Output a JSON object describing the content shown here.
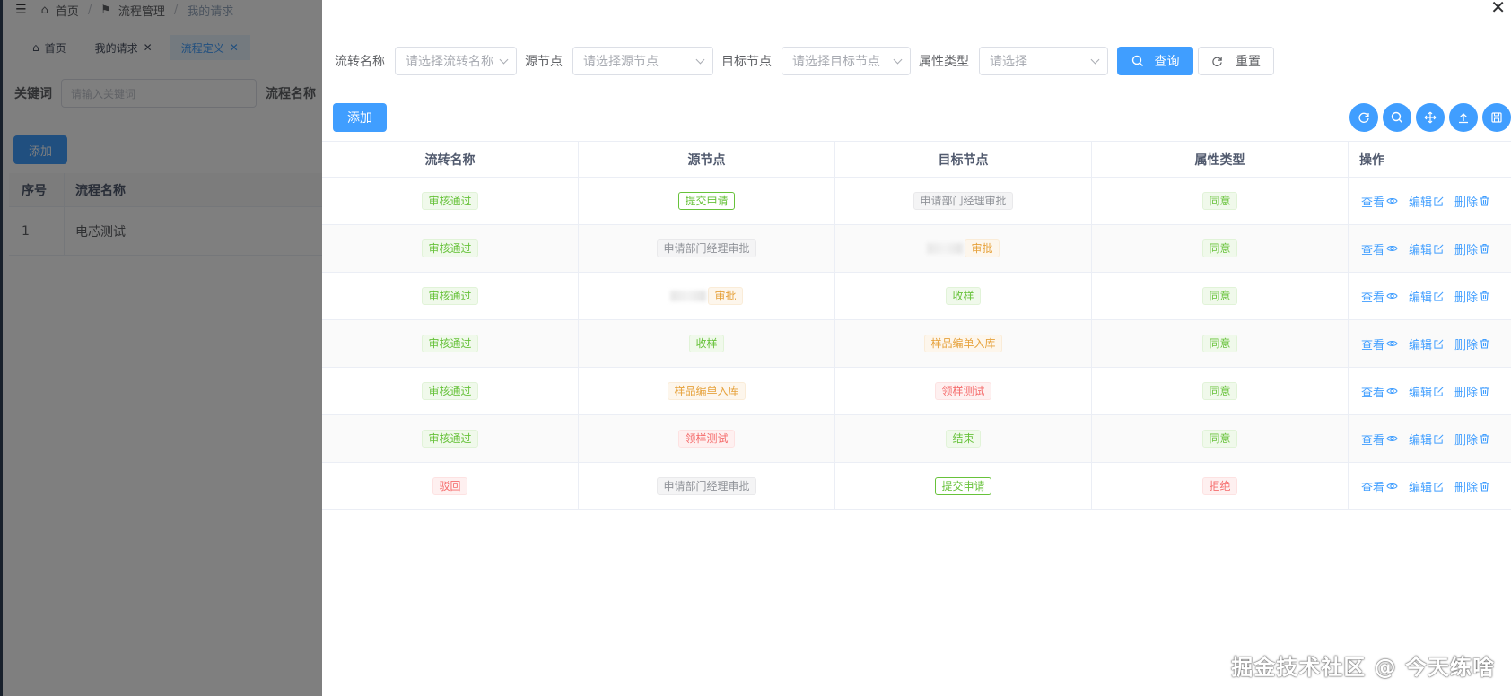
{
  "background": {
    "breadcrumb": [
      "首页",
      "流程管理",
      "我的请求"
    ],
    "tabs": [
      {
        "label": "首页",
        "closable": false,
        "active": false
      },
      {
        "label": "我的请求",
        "closable": true,
        "active": false
      },
      {
        "label": "流程定义",
        "closable": true,
        "active": true
      }
    ],
    "search": {
      "keyword_label": "关键词",
      "keyword_placeholder": "请输入关键词",
      "name_label": "流程名称"
    },
    "add_label": "添加",
    "table": {
      "headers": [
        "序号",
        "流程名称"
      ],
      "rows": [
        [
          "1",
          "电芯测试"
        ]
      ]
    }
  },
  "drawer": {
    "filters": [
      {
        "label": "流转名称",
        "placeholder": "请选择流转名称"
      },
      {
        "label": "源节点",
        "placeholder": "请选择源节点"
      },
      {
        "label": "目标节点",
        "placeholder": "请选择目标节点"
      },
      {
        "label": "属性类型",
        "placeholder": "请选择"
      }
    ],
    "query_label": "查询",
    "reset_label": "重置",
    "add_label": "添加",
    "toolbar_icons": [
      "refresh-icon",
      "search-icon",
      "move-icon",
      "upload-icon",
      "save-icon"
    ],
    "table": {
      "headers": [
        "流转名称",
        "源节点",
        "目标节点",
        "属性类型",
        "操作"
      ],
      "rows": [
        {
          "name": "审核通过",
          "source": "提交申请",
          "target": "申请部门经理审批",
          "type": "同意"
        },
        {
          "name": "审核通过",
          "source": "申请部门经理审批",
          "target": "审批",
          "type": "同意"
        },
        {
          "name": "审核通过",
          "source": "审批",
          "target": "收样",
          "type": "同意"
        },
        {
          "name": "审核通过",
          "source": "收样",
          "target": "样品编单入库",
          "type": "同意"
        },
        {
          "name": "审核通过",
          "source": "样品编单入库",
          "target": "领样测试",
          "type": "同意"
        },
        {
          "name": "审核通过",
          "source": "领样测试",
          "target": "结束",
          "type": "同意"
        },
        {
          "name": "驳回",
          "source": "申请部门经理审批",
          "target": "提交申请",
          "type": "拒绝"
        }
      ],
      "ops": {
        "view": "查看",
        "edit": "编辑",
        "delete": "删除"
      }
    }
  },
  "watermark": "掘金技术社区 @ 今天练啥"
}
